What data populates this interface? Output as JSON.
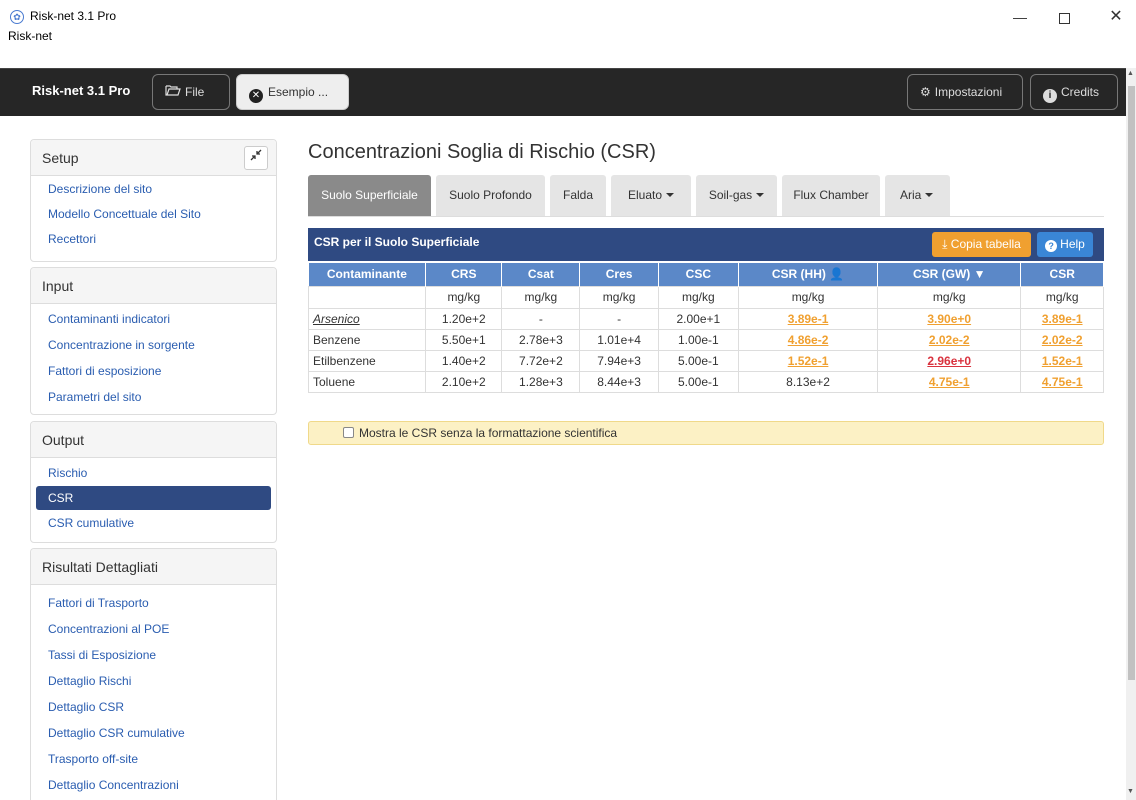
{
  "window": {
    "title": "Risk-net 3.1 Pro",
    "menu": "Risk-net",
    "min_glyph": "—",
    "close_glyph": "✕"
  },
  "toolbar": {
    "brand": "Risk-net 3.1 Pro",
    "file": "File",
    "esempio": "Esempio ...",
    "impostazioni": "Impostazioni",
    "credits": "Credits"
  },
  "sidebar": {
    "setup": {
      "title": "Setup",
      "items": [
        "Descrizione del sito",
        "Modello Concettuale del Sito",
        "Recettori"
      ]
    },
    "input": {
      "title": "Input",
      "items": [
        "Contaminanti indicatori",
        "Concentrazione in sorgente",
        "Fattori di esposizione",
        "Parametri del sito"
      ]
    },
    "output": {
      "title": "Output",
      "items": [
        "Rischio",
        "CSR",
        "CSR cumulative"
      ],
      "active": "CSR"
    },
    "risultati": {
      "title": "Risultati Dettagliati",
      "items": [
        "Fattori di Trasporto",
        "Concentrazioni al POE",
        "Tassi di Esposizione",
        "Dettaglio Rischi",
        "Dettaglio CSR",
        "Dettaglio CSR cumulative",
        "Trasporto off-site",
        "Dettaglio Concentrazioni"
      ]
    }
  },
  "main": {
    "title": "Concentrazioni Soglia di Rischio (CSR)",
    "tabs": [
      "Suolo Superficiale",
      "Suolo Profondo",
      "Falda",
      "Eluato",
      "Soil-gas",
      "Flux Chamber",
      "Aria"
    ],
    "active_tab": "Suolo Superficiale",
    "table_title": "CSR per il Suolo Superficiale",
    "copy_button": "Copia tabella",
    "help_button": "Help",
    "columns": [
      "Contaminante",
      "CRS",
      "Csat",
      "Cres",
      "CSC",
      "CSR (HH)",
      "CSR (GW)",
      "CSR"
    ],
    "units": [
      "",
      "mg/kg",
      "mg/kg",
      "mg/kg",
      "mg/kg",
      "mg/kg",
      "mg/kg",
      "mg/kg"
    ],
    "rows": [
      [
        "Arsenico",
        "1.20e+2",
        "-",
        "-",
        "2.00e+1",
        "3.89e-1",
        "3.90e+0",
        "3.89e-1"
      ],
      [
        "Benzene",
        "5.50e+1",
        "2.78e+3",
        "1.01e+4",
        "1.00e-1",
        "4.86e-2",
        "2.02e-2",
        "2.02e-2"
      ],
      [
        "Etilbenzene",
        "1.40e+2",
        "7.72e+2",
        "7.94e+3",
        "5.00e-1",
        "1.52e-1",
        "2.96e+0",
        "1.52e-1"
      ],
      [
        "Toluene",
        "2.10e+2",
        "1.28e+3",
        "8.44e+3",
        "5.00e-1",
        "8.13e+2",
        "4.75e-1",
        "4.75e-1"
      ]
    ],
    "notice": "Mostra le CSR senza la formattazione scientifica"
  },
  "colors": {
    "navy": "#2f4a82",
    "header_blue": "#5b88c8",
    "orange": "#f0a030",
    "red": "#d9333f",
    "link": "#2a5db0"
  }
}
